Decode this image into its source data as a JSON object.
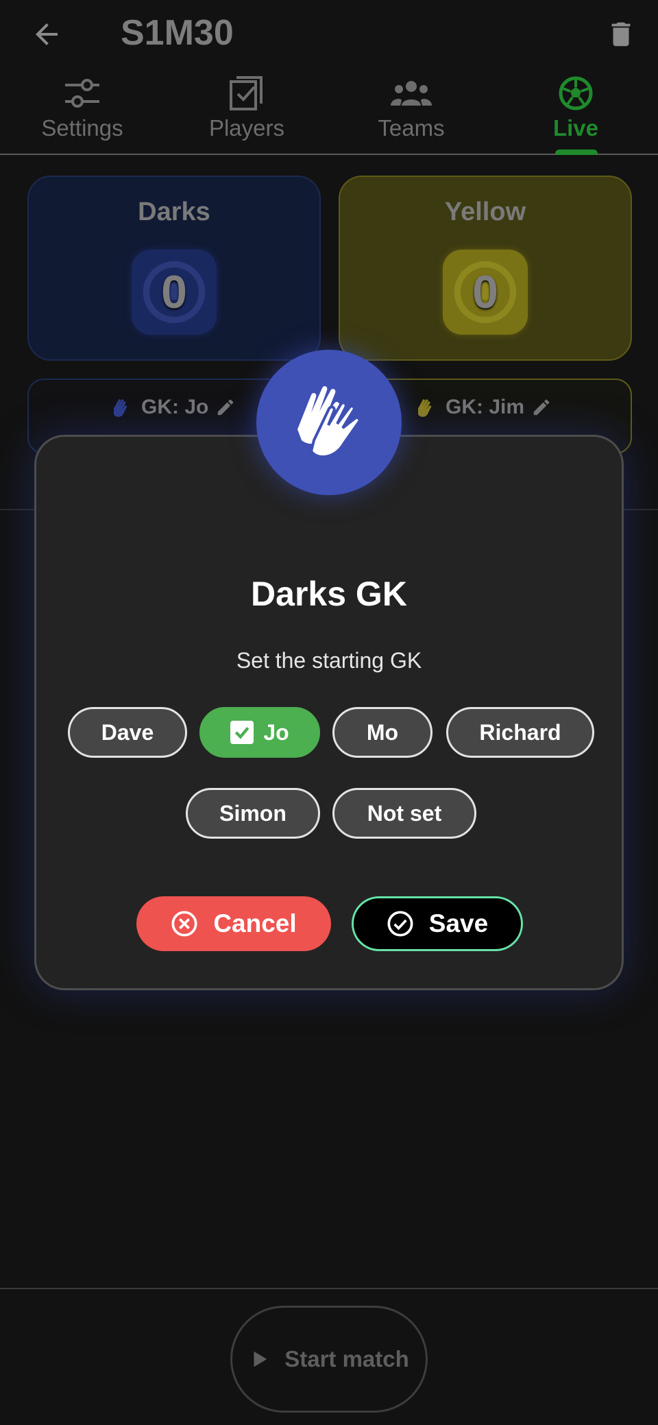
{
  "header": {
    "title": "S1M30"
  },
  "tabs": [
    {
      "label": "Settings",
      "icon": "sliders-icon",
      "active": false
    },
    {
      "label": "Players",
      "icon": "checklist-icon",
      "active": false
    },
    {
      "label": "Teams",
      "icon": "group-icon",
      "active": false
    },
    {
      "label": "Live",
      "icon": "soccer-ball-icon",
      "active": true
    }
  ],
  "teams": {
    "darks": {
      "name": "Darks",
      "score": "0",
      "gk": "GK: Jo",
      "color": "#3f51b5"
    },
    "yellow": {
      "name": "Yellow",
      "score": "0",
      "gk": "GK: Jim",
      "color": "#c9b52a"
    }
  },
  "dialog": {
    "title": "Darks GK",
    "subtitle": "Set the starting GK",
    "players": [
      {
        "label": "Dave",
        "selected": false
      },
      {
        "label": "Jo",
        "selected": true
      },
      {
        "label": "Mo",
        "selected": false
      },
      {
        "label": "Richard",
        "selected": false
      },
      {
        "label": "Simon",
        "selected": false
      },
      {
        "label": "Not set",
        "selected": false
      }
    ],
    "cancel_label": "Cancel",
    "save_label": "Save"
  },
  "footer": {
    "start_label": "Start match"
  },
  "colors": {
    "accent_live": "#1f8a2c",
    "dialog_badge": "#3f51b5",
    "chip_selected": "#4caf50",
    "cancel": "#ef5350",
    "save_border": "#66e3a6"
  }
}
